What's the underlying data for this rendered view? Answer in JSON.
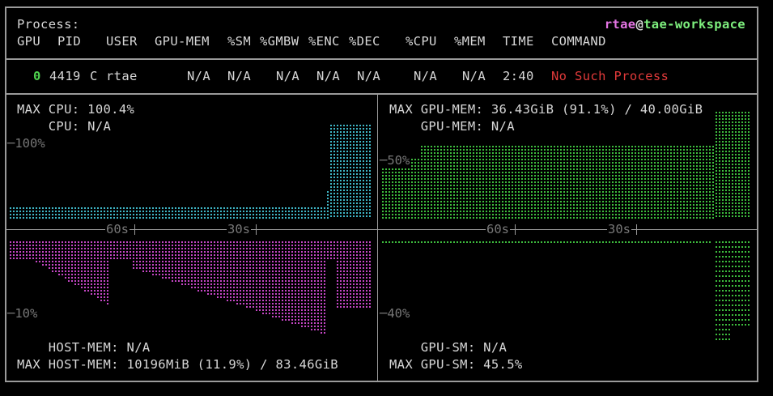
{
  "header": {
    "label": "Process:",
    "user": "rtae",
    "at": "@",
    "host": "tae-workspace",
    "columns": [
      "GPU",
      "PID",
      "USER",
      "GPU-MEM",
      "%SM",
      "%GMBW",
      "%ENC",
      "%DEC",
      "%CPU",
      "%MEM",
      "TIME",
      "COMMAND"
    ]
  },
  "process_row": {
    "gpu": "0",
    "pid": "4419",
    "type": "C",
    "user": "rtae",
    "gpu_mem": "N/A",
    "sm": "N/A",
    "gmbw": "N/A",
    "enc": "N/A",
    "dec": "N/A",
    "cpu": "N/A",
    "mem": "N/A",
    "time": "2:40",
    "command": "No Such Process"
  },
  "panels": {
    "cpu": {
      "max_label": "MAX CPU: 100.4%",
      "cur_label": "    CPU: N/A",
      "y_marker": "100%"
    },
    "gpu_mem": {
      "max_label": "MAX GPU-MEM: 36.43GiB (91.1%) / 40.00GiB",
      "cur_label": "    GPU-MEM: N/A",
      "y_marker": "50%"
    },
    "host_mem": {
      "cur_label": "    HOST-MEM: N/A",
      "max_label": "MAX HOST-MEM: 10196MiB (11.9%) / 83.46GiB",
      "y_marker": "10%"
    },
    "gpu_sm": {
      "cur_label": "    GPU-SM: N/A",
      "max_label": "MAX GPU-SM: 45.5%",
      "y_marker": "40%"
    }
  },
  "time_axis": {
    "left_labels": [
      "60s",
      "30s"
    ],
    "right_labels": [
      "60s",
      "30s"
    ]
  },
  "colors": {
    "cpu": "#3fb6c6",
    "gpu_mem": "#3dbd3d",
    "host_mem": "#c546c5",
    "gpu_sm": "#3dbd3d",
    "error": "#e03a3a",
    "user": "#e575e5",
    "host": "#7ef07e"
  }
}
